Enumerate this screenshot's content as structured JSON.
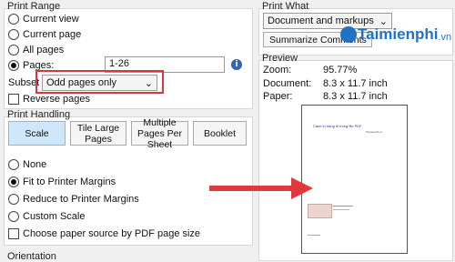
{
  "print_range": {
    "title": "Print Range",
    "current_view": "Current view",
    "current_page": "Current page",
    "all_pages": "All pages",
    "pages_label": "Pages:",
    "pages_value": "1-26",
    "subset_label": "Subset",
    "subset_value": "Odd pages only",
    "reverse_pages": "Reverse pages"
  },
  "print_handling": {
    "title": "Print Handling",
    "scale_btn": "Scale",
    "tile_btn": "Tile Large Pages",
    "multiple_btn": "Multiple Pages Per Sheet",
    "booklet_btn": "Booklet",
    "none": "None",
    "fit": "Fit to Printer Margins",
    "reduce": "Reduce to Printer Margins",
    "custom": "Custom Scale",
    "choose_paper": "Choose paper source by PDF page size"
  },
  "orientation": {
    "title": "Orientation"
  },
  "print_what": {
    "title": "Print What",
    "value": "Document and markups",
    "summarize_btn": "Summarize Comments"
  },
  "preview": {
    "title": "Preview",
    "zoom_label": "Zoom:",
    "zoom_value": "95.77%",
    "document_label": "Document:",
    "document_value": "8.3 x 11.7 inch",
    "paper_label": "Paper:",
    "paper_value": "8.3 x 11.7 inch",
    "page_heading": "Cách in trang lẻ trong file PDF",
    "page_subheading": "Taimienphi.vn"
  },
  "watermark": {
    "text": "Taimienphi",
    "suffix": ".vn"
  },
  "colors": {
    "arrow": "#e0393b",
    "highlight": "#d9363e",
    "active_button": "#cfe6fb"
  }
}
